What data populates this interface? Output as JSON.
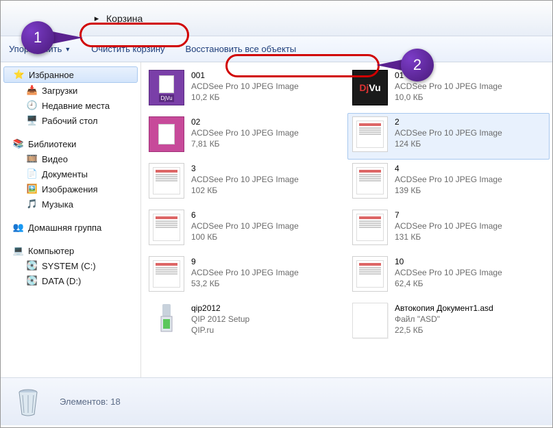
{
  "address": {
    "location": "Корзина"
  },
  "callouts": {
    "one": "1",
    "two": "2"
  },
  "toolbar": {
    "organize": "Упорядочить",
    "empty": "Очистить корзину",
    "restore": "Восстановить все объекты"
  },
  "sidebar": {
    "favorites": {
      "label": "Избранное",
      "downloads": "Загрузки",
      "recent": "Недавние места",
      "desktop": "Рабочий стол"
    },
    "libraries": {
      "label": "Библиотеки",
      "video": "Видео",
      "documents": "Документы",
      "images": "Изображения",
      "music": "Музыка"
    },
    "homegroup": {
      "label": "Домашняя группа"
    },
    "computer": {
      "label": "Компьютер",
      "system": "SYSTEM (C:)",
      "data": "DATA (D:)"
    }
  },
  "files": [
    {
      "name": "001",
      "type": "ACDSee Pro 10 JPEG Image",
      "size": "10,2 КБ",
      "thumb": "djvu"
    },
    {
      "name": "01",
      "type": "ACDSee Pro 10 JPEG Image",
      "size": "10,0 КБ",
      "thumb": "black"
    },
    {
      "name": "02",
      "type": "ACDSee Pro 10 JPEG Image",
      "size": "7,81 КБ",
      "thumb": "pink"
    },
    {
      "name": "2",
      "type": "ACDSee Pro 10 JPEG Image",
      "size": "124 КБ",
      "thumb": "doc",
      "selected": true
    },
    {
      "name": "3",
      "type": "ACDSee Pro 10 JPEG Image",
      "size": "102 КБ",
      "thumb": "doc"
    },
    {
      "name": "4",
      "type": "ACDSee Pro 10 JPEG Image",
      "size": "139 КБ",
      "thumb": "doc"
    },
    {
      "name": "6",
      "type": "ACDSee Pro 10 JPEG Image",
      "size": "100 КБ",
      "thumb": "doc"
    },
    {
      "name": "7",
      "type": "ACDSee Pro 10 JPEG Image",
      "size": "131 КБ",
      "thumb": "doc"
    },
    {
      "name": "9",
      "type": "ACDSee Pro 10 JPEG Image",
      "size": "53,2 КБ",
      "thumb": "doc"
    },
    {
      "name": "10",
      "type": "ACDSee Pro 10 JPEG Image",
      "size": "62,4 КБ",
      "thumb": "doc"
    },
    {
      "name": "qip2012",
      "type": "QIP 2012 Setup",
      "size": "QIP.ru",
      "thumb": "qip"
    },
    {
      "name": "Автокопия Документ1.asd",
      "type": "Файл \"ASD\"",
      "size": "22,5 КБ",
      "thumb": "blank"
    }
  ],
  "status": {
    "count_label": "Элементов: 18"
  }
}
